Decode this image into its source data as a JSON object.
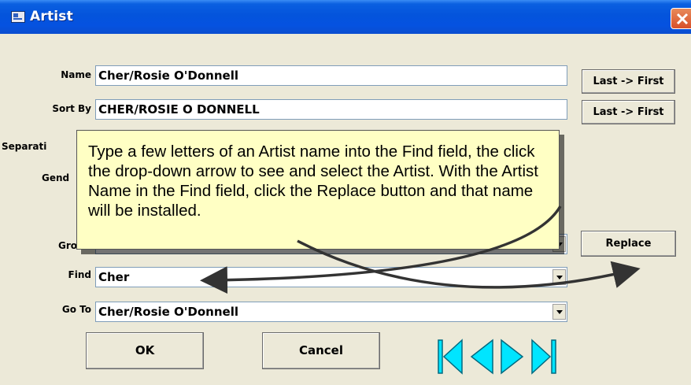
{
  "window": {
    "title": "Artist",
    "close_label": "Close"
  },
  "form": {
    "name_label": "Name",
    "name_value": "Cher/Rosie O'Donnell",
    "sortby_label": "Sort By",
    "sortby_value": "CHER/ROSIE O DONNELL",
    "separation_label": "Separati",
    "gender_label": "Gend",
    "group_label": "Gro",
    "find_label": "Find",
    "find_value": "Cher",
    "goto_label": "Go To",
    "goto_value": "Cher/Rosie O'Donnell"
  },
  "buttons": {
    "last_first_1": "Last -> First",
    "last_first_2": "Last -> First",
    "replace": "Replace",
    "ok": "OK",
    "cancel": "Cancel"
  },
  "navigation": {
    "icons": [
      "first-record-icon",
      "previous-record-icon",
      "next-record-icon",
      "last-record-icon"
    ],
    "color": "#00e5ff"
  },
  "tooltip": {
    "text": "Type a few letters of an Artist name into the Find field, the click the drop-down arrow to see and select the Artist.  With the Artist Name in the Find field, click the Replace button and that name will be installed."
  }
}
